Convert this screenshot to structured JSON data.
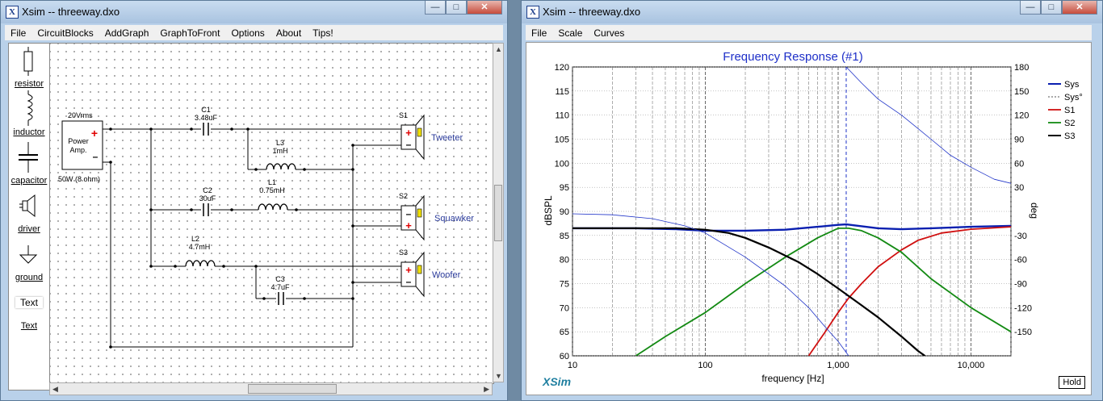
{
  "left_window": {
    "title": "Xsim -- threeway.dxo",
    "menu": [
      "File",
      "CircuitBlocks",
      "AddGraph",
      "GraphToFront",
      "Options",
      "About",
      "Tips!"
    ],
    "palette": [
      {
        "label": "resistor",
        "icon": "resistor-icon"
      },
      {
        "label": "inductor",
        "icon": "inductor-icon"
      },
      {
        "label": "capacitor",
        "icon": "capacitor-icon"
      },
      {
        "label": "driver",
        "icon": "driver-icon"
      },
      {
        "label": "ground",
        "icon": "ground-icon"
      },
      {
        "label": "Text",
        "icon": "text-icon"
      }
    ],
    "text_preview": "Text"
  },
  "circuit": {
    "amp": {
      "label_top": "20Vrms",
      "name_line1": "Power",
      "name_line2": "Amp.",
      "label_bottom": "50W (8 ohm)"
    },
    "components": [
      {
        "id": "C1",
        "name": "C1",
        "value": "3.48uF"
      },
      {
        "id": "L3",
        "name": "L3",
        "value": "1mH"
      },
      {
        "id": "C2",
        "name": "C2",
        "value": "30uF"
      },
      {
        "id": "L1",
        "name": "L1",
        "value": "0.75mH"
      },
      {
        "id": "L2",
        "name": "L2",
        "value": "4.7mH"
      },
      {
        "id": "C3",
        "name": "C3",
        "value": "4.7uF"
      }
    ],
    "drivers": [
      {
        "ref": "S1",
        "name": "Tweeter"
      },
      {
        "ref": "S2",
        "name": "Squawker"
      },
      {
        "ref": "S3",
        "name": "Woofer"
      }
    ]
  },
  "right_window": {
    "title": "Xsim -- threeway.dxo",
    "menu": [
      "File",
      "Scale",
      "Curves"
    ],
    "hold_label": "Hold",
    "brand": "XSim"
  },
  "chart_data": {
    "type": "line",
    "title": "Frequency Response (#1)",
    "xlabel": "frequency [Hz]",
    "ylabel": "dBSPL",
    "y2label": "deg",
    "xscale": "log",
    "xlim": [
      10,
      20000
    ],
    "ylim": [
      60,
      120
    ],
    "y2lim": [
      -180,
      180
    ],
    "x_ticks": [
      10,
      100,
      1000,
      10000
    ],
    "x_tick_labels": [
      "10",
      "100",
      "1,000",
      "10,000"
    ],
    "y_ticks": [
      60,
      65,
      70,
      75,
      80,
      85,
      90,
      95,
      100,
      105,
      110,
      115,
      120
    ],
    "y2_ticks": [
      180,
      150,
      120,
      90,
      60,
      30,
      -30,
      -60,
      -90,
      -120,
      -150
    ],
    "grid": true,
    "legend": "right",
    "cursor_x": 1150,
    "series": [
      {
        "name": "Sys",
        "axis": "y",
        "color": "#0a1fb0",
        "width": 2.4,
        "dash": "",
        "x": [
          10,
          30,
          60,
          100,
          200,
          400,
          700,
          1000,
          1150,
          2000,
          3000,
          5000,
          10000,
          20000
        ],
        "y": [
          86.5,
          86.5,
          86.3,
          86.0,
          86.0,
          86.2,
          86.8,
          87.2,
          87.3,
          86.5,
          86.3,
          86.5,
          86.8,
          87.0
        ]
      },
      {
        "name": "Sys°",
        "axis": "y2",
        "color": "#555555",
        "width": 1,
        "dash": "3,3",
        "x": [],
        "y": []
      },
      {
        "name": "S1",
        "axis": "y",
        "color": "#d01010",
        "width": 1.8,
        "dash": "",
        "x": [
          600,
          800,
          1000,
          1200,
          1500,
          2000,
          3000,
          4000,
          6000,
          10000,
          20000
        ],
        "y": [
          60,
          65,
          69,
          72,
          75,
          78.5,
          82,
          84,
          85.5,
          86.3,
          86.8
        ]
      },
      {
        "name": "S2",
        "axis": "y",
        "color": "#138a13",
        "width": 1.8,
        "dash": "",
        "x": [
          30,
          50,
          100,
          200,
          400,
          700,
          1000,
          1200,
          1500,
          2000,
          3000,
          5000,
          10000,
          20000
        ],
        "y": [
          60,
          64,
          69,
          75,
          80.5,
          84.5,
          86.5,
          86.5,
          86.0,
          84.5,
          81.5,
          76,
          70,
          65
        ]
      },
      {
        "name": "S3",
        "axis": "y",
        "color": "#000000",
        "width": 2.2,
        "dash": "",
        "x": [
          10,
          30,
          60,
          100,
          150,
          200,
          300,
          500,
          700,
          1000,
          1500,
          2000,
          3000,
          4000,
          4500
        ],
        "y": [
          86.5,
          86.5,
          86.5,
          86.2,
          85.5,
          84.5,
          82.5,
          79.5,
          77,
          74,
          70.5,
          68,
          64,
          61,
          60
        ]
      },
      {
        "name": "",
        "axis": "y",
        "color": "#1e32c8",
        "width": 0.8,
        "dash": "",
        "x": [
          10,
          20,
          40,
          70,
          100,
          200,
          400,
          600,
          800,
          1000,
          1200
        ],
        "y": [
          89.5,
          89.3,
          88.5,
          87,
          85.5,
          80.5,
          74.5,
          70,
          66,
          63,
          60
        ]
      },
      {
        "name": "",
        "axis": "y2",
        "color": "#1e32c8",
        "width": 0.8,
        "dash": "",
        "x": [
          1150,
          1500,
          2000,
          3000,
          5000,
          7000,
          10000,
          15000,
          20000
        ],
        "y": [
          180,
          160,
          140,
          120,
          90,
          70,
          55,
          40,
          35
        ]
      }
    ]
  }
}
